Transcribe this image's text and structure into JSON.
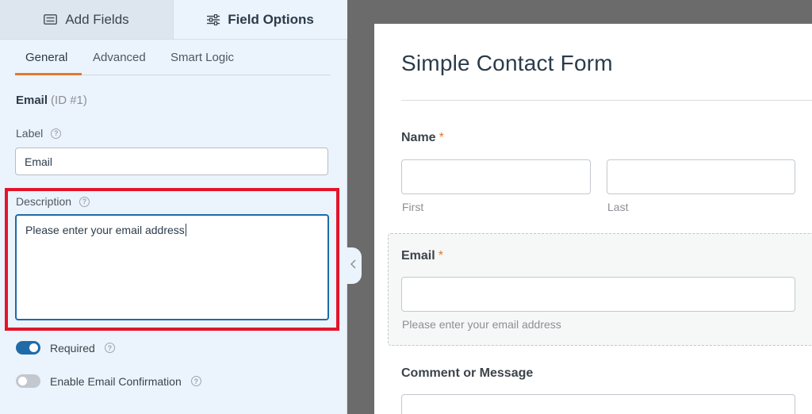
{
  "top_tabs": {
    "add_fields": "Add Fields",
    "field_options": "Field Options"
  },
  "sub_tabs": {
    "general": "General",
    "advanced": "Advanced",
    "smart_logic": "Smart Logic"
  },
  "field": {
    "name": "Email",
    "id_text": "(ID #1)"
  },
  "label_field": {
    "label": "Label",
    "value": "Email"
  },
  "description_field": {
    "label": "Description",
    "value": "Please enter your email address"
  },
  "toggles": {
    "required": {
      "label": "Required",
      "on": true
    },
    "email_confirmation": {
      "label": "Enable Email Confirmation",
      "on": false
    }
  },
  "help_glyph": "?",
  "preview": {
    "title": "Simple Contact Form",
    "required_marker": "*",
    "name": {
      "label": "Name",
      "first_sub": "First",
      "last_sub": "Last"
    },
    "email": {
      "label": "Email",
      "description": "Please enter your email address"
    },
    "comment": {
      "label": "Comment or Message"
    }
  },
  "colors": {
    "accent_orange": "#e27730",
    "toggle_blue": "#1e6ba8",
    "highlight_red": "#e3142a",
    "panel_bg": "#ebf3fc"
  }
}
